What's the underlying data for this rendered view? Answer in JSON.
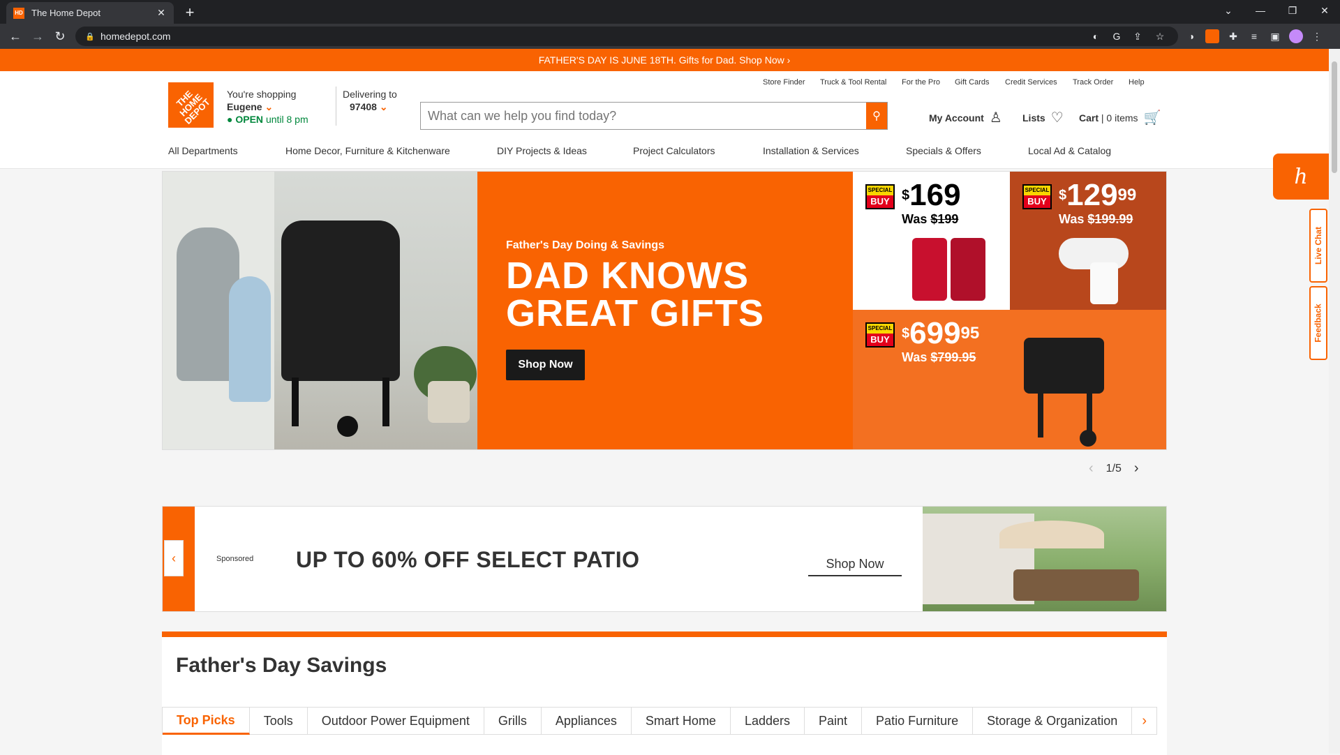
{
  "browser": {
    "tab_title": "The Home Depot",
    "url": "homedepot.com"
  },
  "promo": {
    "text": "FATHER'S DAY IS JUNE 18TH. Gifts for Dad. Shop Now  ›"
  },
  "header": {
    "logo_text": "THE HOME DEPOT",
    "shopping_label": "You're shopping",
    "store_name": "Eugene",
    "open_label": "OPEN",
    "open_hours": "until 8 pm",
    "delivering_label": "Delivering to",
    "zip": "97408",
    "utility_links": [
      "Store Finder",
      "Truck & Tool Rental",
      "For the Pro",
      "Gift Cards",
      "Credit Services",
      "Track Order",
      "Help"
    ],
    "search_placeholder": "What can we help you find today?",
    "account_label": "My Account",
    "lists_label": "Lists",
    "cart_label": "Cart",
    "cart_items": "| 0 items",
    "nav": [
      "All Departments",
      "Home Decor, Furniture & Kitchenware",
      "DIY Projects & Ideas",
      "Project Calculators",
      "Installation & Services",
      "Specials & Offers",
      "Local Ad & Catalog"
    ]
  },
  "hero": {
    "subtitle": "Father's Day Doing & Savings",
    "headline": "DAD KNOWS GREAT GIFTS",
    "cta": "Shop Now",
    "deals": [
      {
        "badge_top": "SPECIAL",
        "badge_bottom": "BUY",
        "price": "169",
        "cents": "",
        "was_label": "Was",
        "was": "$199"
      },
      {
        "badge_top": "SPECIAL",
        "badge_bottom": "BUY",
        "price": "129",
        "cents": "99",
        "was_label": "Was",
        "was": "$199.99"
      },
      {
        "badge_top": "SPECIAL",
        "badge_bottom": "BUY",
        "price": "699",
        "cents": "95",
        "was_label": "Was",
        "was": "$799.95"
      }
    ],
    "pager": "1/5"
  },
  "sponsored": {
    "label": "Sponsored",
    "text": "UP TO 60% OFF SELECT PATIO",
    "cta": "Shop Now"
  },
  "fathers_day": {
    "heading": "Father's Day Savings",
    "tabs": [
      "Top Picks",
      "Tools",
      "Outdoor Power Equipment",
      "Grills",
      "Appliances",
      "Smart Home",
      "Ladders",
      "Paint",
      "Patio Furniture",
      "Storage & Organization"
    ]
  },
  "side": {
    "live_chat": "Live Chat",
    "feedback": "Feedback"
  },
  "colors": {
    "brand_orange": "#f96302",
    "open_green": "#00873c"
  }
}
